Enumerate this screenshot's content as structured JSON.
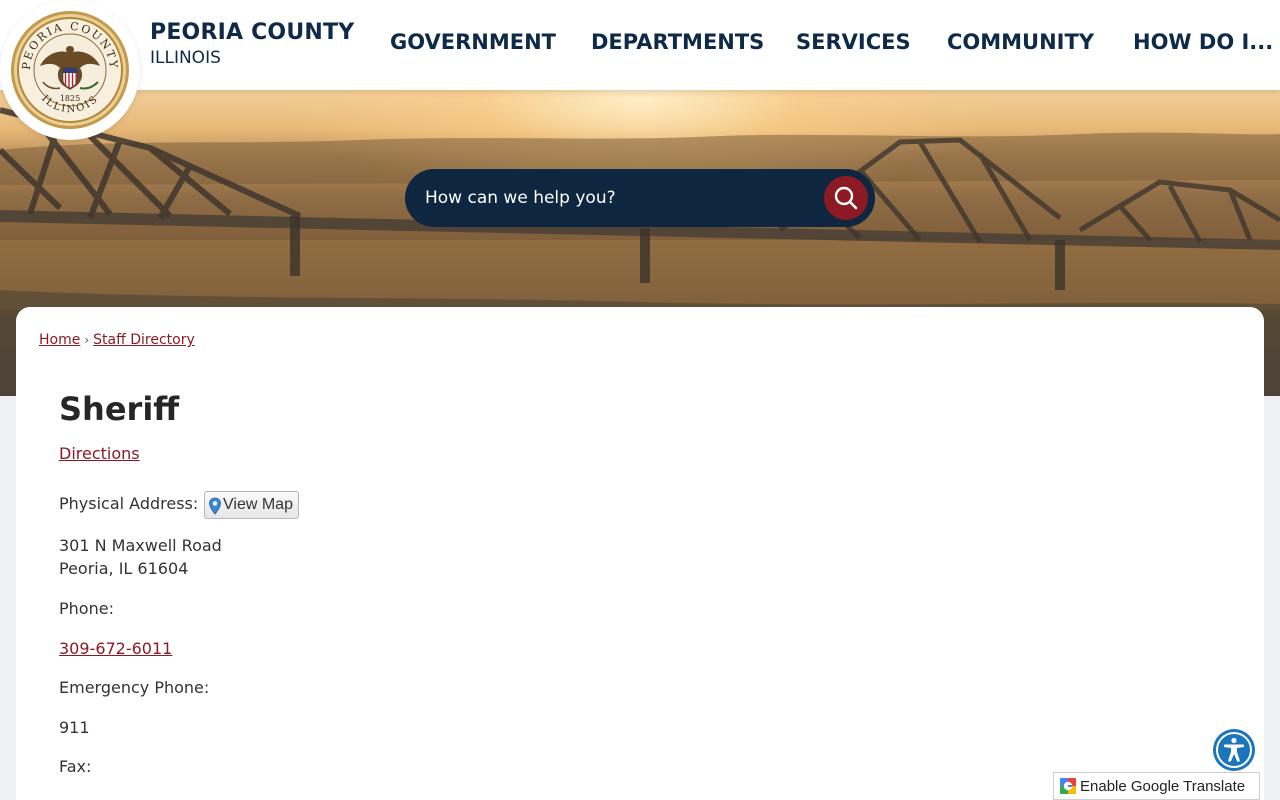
{
  "header": {
    "county_name": "PEORIA COUNTY",
    "state": "ILLINOIS",
    "seal": {
      "top_text": "PEORIA COUNTY",
      "bottom_text": "ILLINOIS",
      "year": "1825",
      "icon": "county-seal-icon"
    },
    "nav": [
      {
        "label": "GOVERNMENT"
      },
      {
        "label": "DEPARTMENTS"
      },
      {
        "label": "SERVICES"
      },
      {
        "label": "COMMUNITY"
      },
      {
        "label": "HOW DO I..."
      }
    ]
  },
  "search": {
    "placeholder": "How can we help you?",
    "button_icon": "search-icon"
  },
  "breadcrumb": {
    "home": "Home",
    "separator": "›",
    "current": "Staff Directory"
  },
  "page": {
    "title": "Sheriff",
    "directions_label": "Directions",
    "physical_address_label": "Physical Address:",
    "view_map_label": "View Map",
    "address_line1": "301 N Maxwell Road",
    "address_line2": "Peoria, IL 61604",
    "phone_label": "Phone:",
    "phone": "309-672-6011",
    "emergency_phone_label": "Emergency Phone:",
    "emergency_phone": "911",
    "fax_label": "Fax:"
  },
  "widgets": {
    "accessibility_icon": "accessibility-icon",
    "translate_label": "Enable Google Translate",
    "translate_icon": "google-translate-icon"
  },
  "colors": {
    "navy": "#0e2a47",
    "accent_red": "#8b1a24",
    "accessibility_blue": "#1b75bb"
  }
}
